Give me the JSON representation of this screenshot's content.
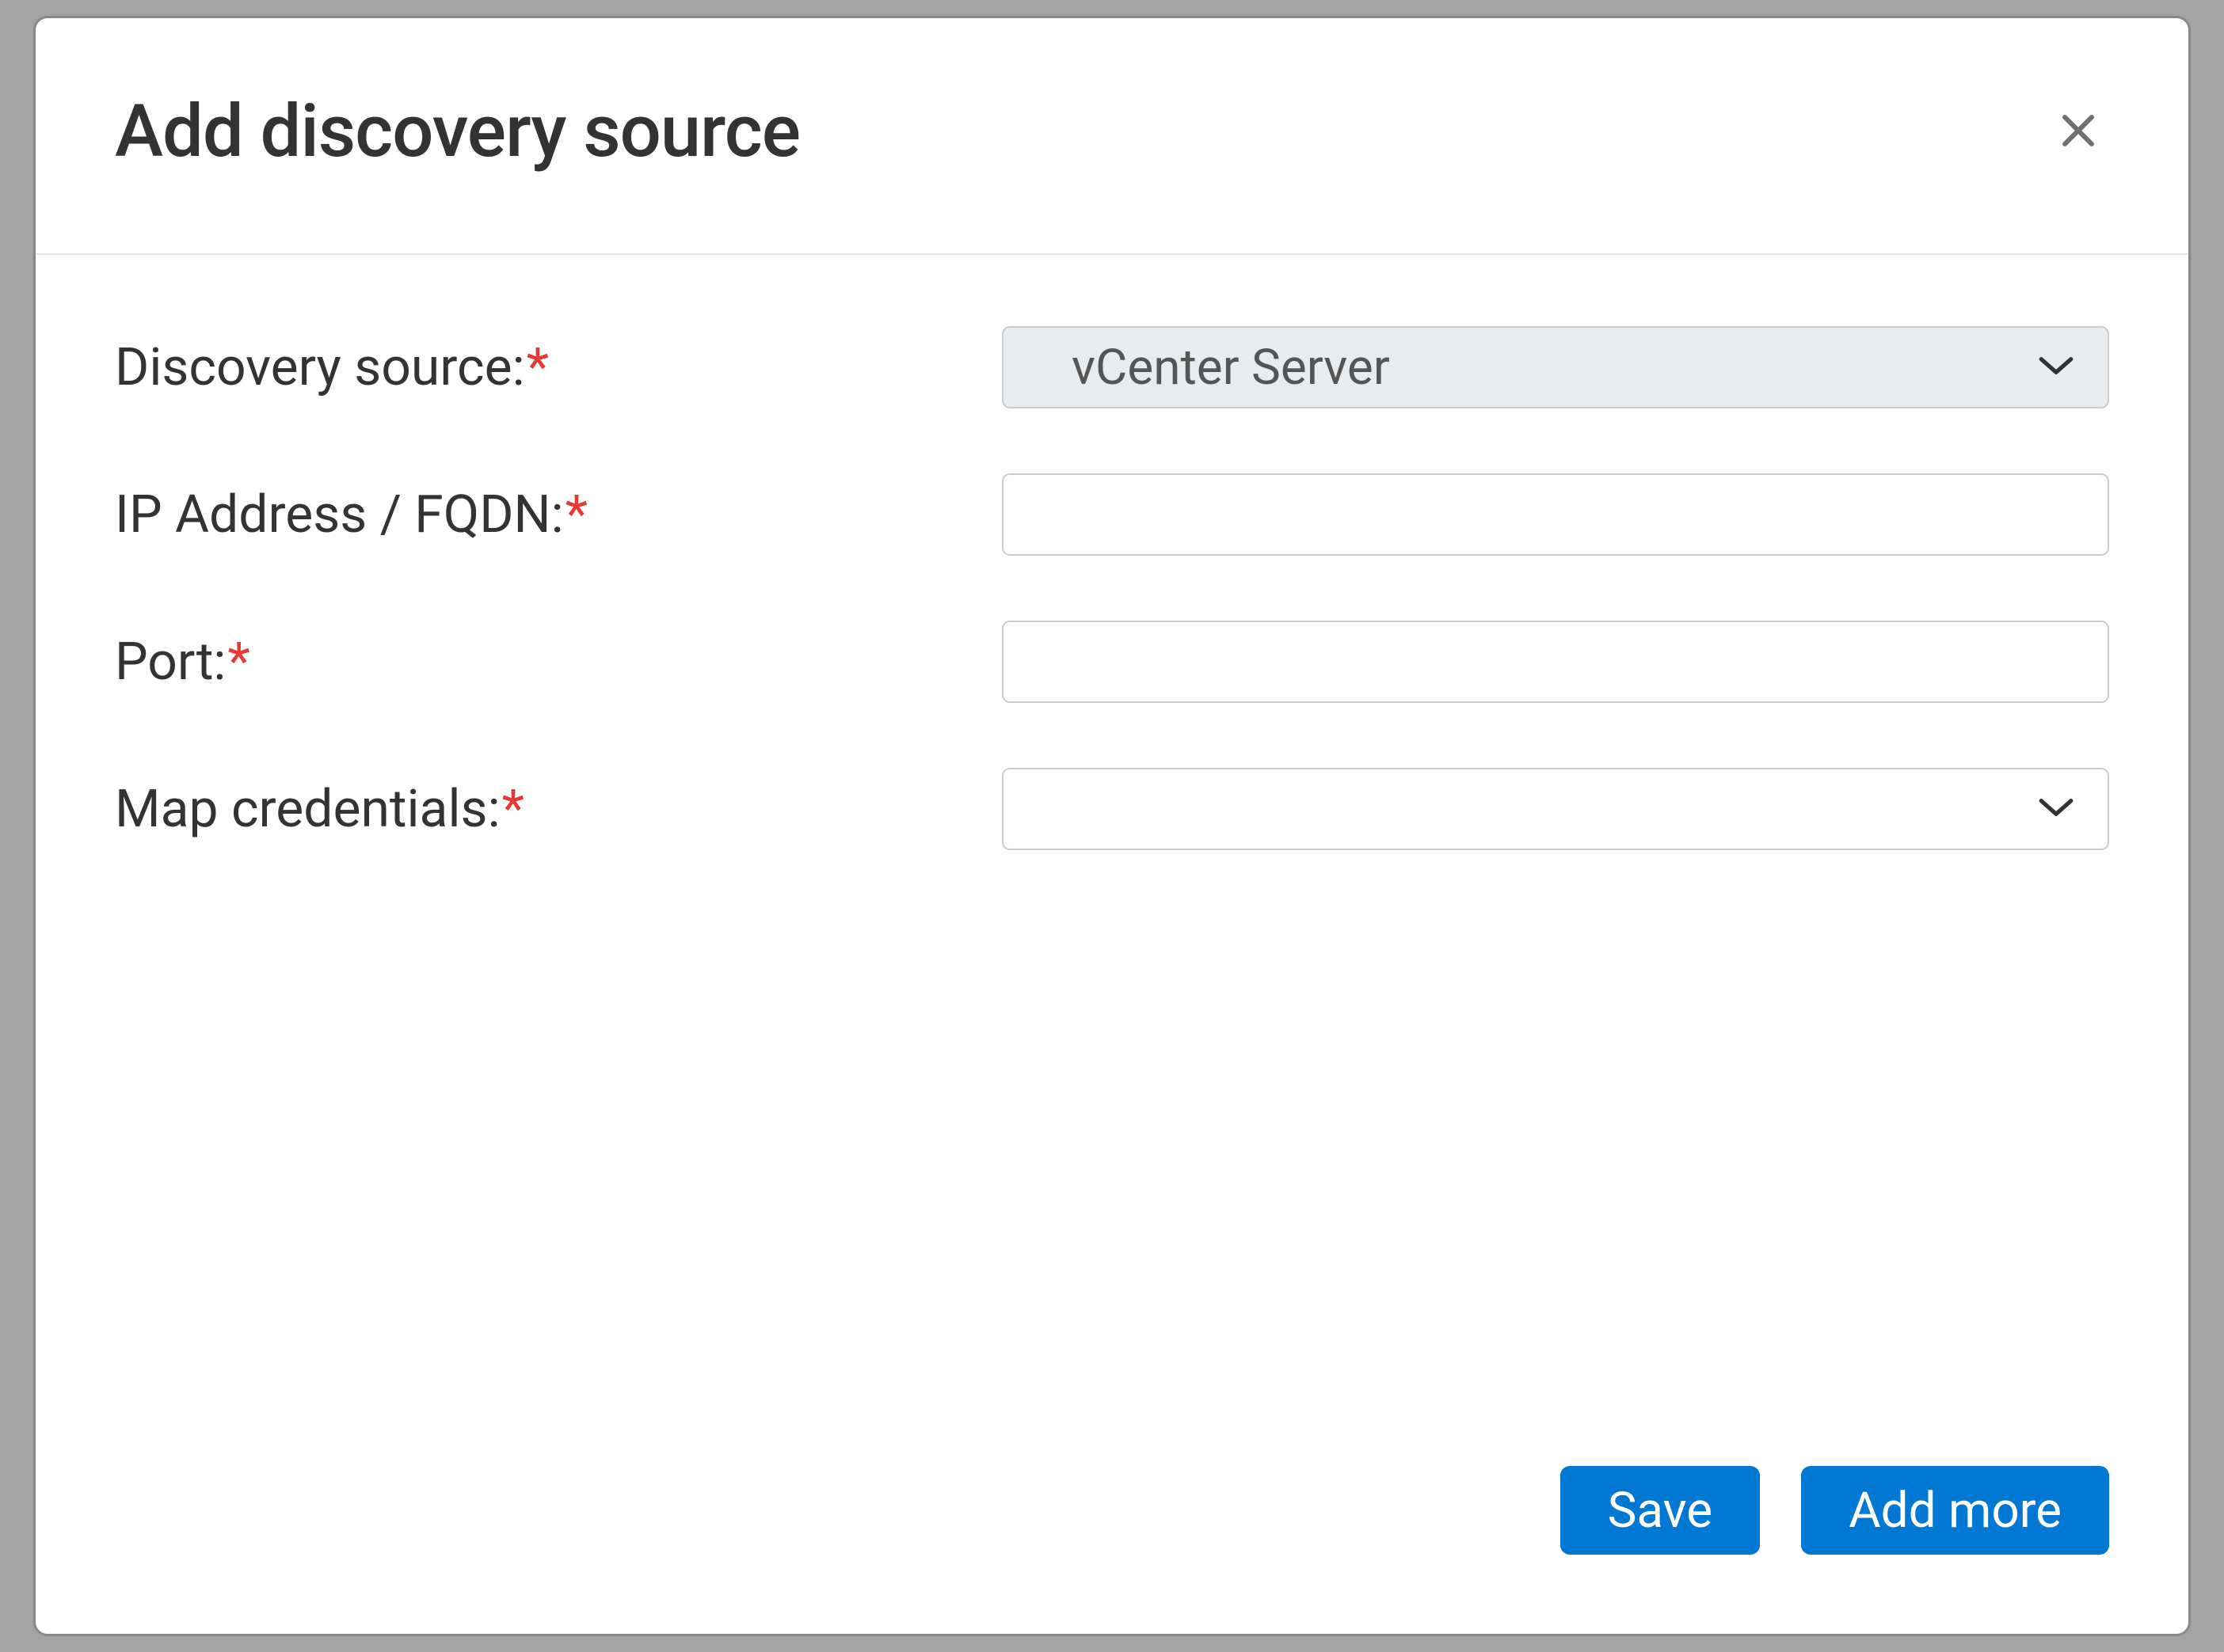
{
  "modal": {
    "title": "Add discovery source",
    "fields": {
      "discovery_source": {
        "label": "Discovery source:",
        "value": "vCenter Server"
      },
      "ip_address": {
        "label": "IP Address / FQDN:",
        "value": ""
      },
      "port": {
        "label": "Port:",
        "value": ""
      },
      "map_credentials": {
        "label": "Map credentials:",
        "value": ""
      }
    },
    "buttons": {
      "save": "Save",
      "add_more": "Add more"
    }
  }
}
